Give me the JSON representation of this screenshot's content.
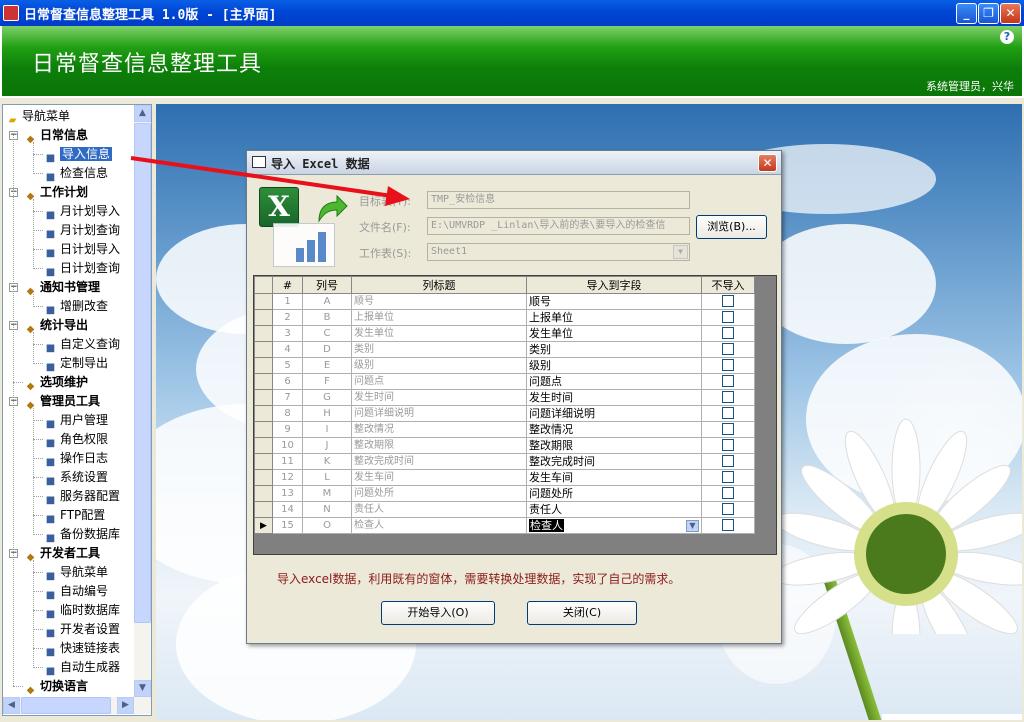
{
  "window": {
    "title": "日常督查信息整理工具 1.0版 - [主界面]",
    "controls": [
      "_",
      "❐",
      "✕"
    ]
  },
  "banner": {
    "title": "日常督查信息整理工具",
    "help": "?",
    "user": "系统管理员，兴华"
  },
  "tree": {
    "root": "导航菜单",
    "groups": [
      {
        "label": "日常信息",
        "icon": "notebook-icon",
        "items": [
          {
            "label": "导入信息",
            "icon": "excel-import-icon",
            "selected": true
          },
          {
            "label": "检查信息",
            "icon": "help-icon"
          }
        ]
      },
      {
        "label": "工作计划",
        "icon": "house-icon",
        "items": [
          {
            "label": "月计划导入",
            "icon": "excel-import-icon"
          },
          {
            "label": "月计划查询",
            "icon": "document-icon"
          },
          {
            "label": "日计划导入",
            "icon": "list-icon"
          },
          {
            "label": "日计划查询",
            "icon": "help-icon"
          }
        ]
      },
      {
        "label": "通知书管理",
        "icon": "tools-icon",
        "items": [
          {
            "label": "增删改查",
            "icon": "document-icon"
          }
        ]
      },
      {
        "label": "统计导出",
        "icon": "gear-icon",
        "items": [
          {
            "label": "自定义查询",
            "icon": "magnifier-icon"
          },
          {
            "label": "定制导出",
            "icon": "person-icon"
          }
        ]
      },
      {
        "label": "选项维护",
        "icon": "people-icon",
        "items": []
      },
      {
        "label": "管理员工具",
        "icon": "star-icon",
        "items": [
          {
            "label": "用户管理",
            "icon": "users-icon"
          },
          {
            "label": "角色权限",
            "icon": "stop-icon"
          },
          {
            "label": "操作日志",
            "icon": "document-icon"
          },
          {
            "label": "系统设置",
            "icon": "document-icon"
          },
          {
            "label": "服务器配置",
            "icon": "database-icon"
          },
          {
            "label": "FTP配置",
            "icon": "document-icon"
          },
          {
            "label": "备份数据库",
            "icon": "database-icon"
          }
        ]
      },
      {
        "label": "开发者工具",
        "icon": "tools-icon",
        "items": [
          {
            "label": "导航菜单",
            "icon": "document-icon"
          },
          {
            "label": "自动编号",
            "icon": "list-icon"
          },
          {
            "label": "临时数据库",
            "icon": "notebook-icon"
          },
          {
            "label": "开发者设置",
            "icon": "gear-icon"
          },
          {
            "label": "快速链接表",
            "icon": "link-icon"
          },
          {
            "label": "自动生成器",
            "icon": "pencil-icon"
          }
        ]
      },
      {
        "label": "切换语言",
        "icon": "excel-import-icon",
        "items": []
      }
    ]
  },
  "dialog": {
    "title": "导入 Excel 数据",
    "close": "✕",
    "target_table_label": "目标表(T):",
    "target_table_value": "TMP_安检信息",
    "file_label": "文件名(F):",
    "file_value": "E:\\UMVRDP _Linlan\\导入前的表\\要导入的检查信",
    "browse_label": "浏览(B)...",
    "sheet_label": "工作表(S):",
    "sheet_value": "Sheet1",
    "columns": [
      "#",
      "列号",
      "列标题",
      "导入到字段",
      "不导入"
    ],
    "rows": [
      {
        "n": "1",
        "col": "A",
        "title": "顺号",
        "field": "顺号"
      },
      {
        "n": "2",
        "col": "B",
        "title": "上报单位",
        "field": "上报单位"
      },
      {
        "n": "3",
        "col": "C",
        "title": "发生单位",
        "field": "发生单位"
      },
      {
        "n": "4",
        "col": "D",
        "title": "类别",
        "field": "类别"
      },
      {
        "n": "5",
        "col": "E",
        "title": "级别",
        "field": "级别"
      },
      {
        "n": "6",
        "col": "F",
        "title": "问题点",
        "field": "问题点"
      },
      {
        "n": "7",
        "col": "G",
        "title": "发生时间",
        "field": "发生时间"
      },
      {
        "n": "8",
        "col": "H",
        "title": "问题详细说明",
        "field": "问题详细说明"
      },
      {
        "n": "9",
        "col": "I",
        "title": "整改情况",
        "field": "整改情况"
      },
      {
        "n": "10",
        "col": "J",
        "title": "整改期限",
        "field": "整改期限"
      },
      {
        "n": "11",
        "col": "K",
        "title": "整改完成时间",
        "field": "整改完成时间"
      },
      {
        "n": "12",
        "col": "L",
        "title": "发生车间",
        "field": "发生车间"
      },
      {
        "n": "13",
        "col": "M",
        "title": "问题处所",
        "field": "问题处所"
      },
      {
        "n": "14",
        "col": "N",
        "title": "责任人",
        "field": "责任人"
      },
      {
        "n": "15",
        "col": "O",
        "title": "检查人",
        "field": "检查人",
        "current": true
      }
    ],
    "note": "导入excel数据，利用既有的窗体，需要转换处理数据，实现了自己的需求。",
    "start_label": "开始导入(O)",
    "close_label": "关闭(C)"
  },
  "colors": {
    "titlebar": "#0a5fe6",
    "banner": "#0d7f0a",
    "note": "#8b1a1a",
    "arrow": "#e8101a",
    "selection": "#316ac5"
  }
}
